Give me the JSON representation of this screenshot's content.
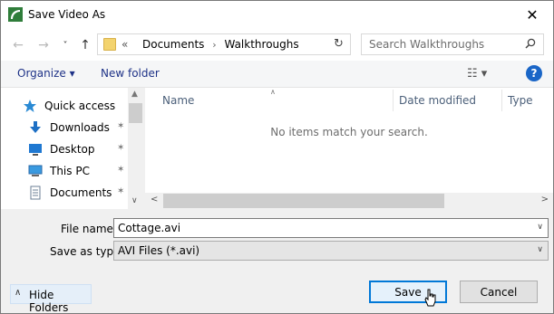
{
  "window": {
    "title": "Save Video As",
    "close_glyph": "✕"
  },
  "nav_buttons": {
    "back": "←",
    "forward": "→",
    "recent": "˅",
    "up": "↑"
  },
  "address": {
    "overflow": "«",
    "crumbs": [
      "Documents",
      "Walkthroughs"
    ],
    "separator": "›",
    "dropdown_glyph": "˅",
    "refresh_glyph": "↻"
  },
  "search": {
    "placeholder": "Search Walkthroughs"
  },
  "toolbar": {
    "organize": "Organize ▾",
    "new_folder": "New folder",
    "view": "☷  ▾",
    "help": "?"
  },
  "sidebar": {
    "items": [
      {
        "label": "Quick access",
        "icon": "star-icon",
        "pinned": false
      },
      {
        "label": "Downloads",
        "icon": "download-icon",
        "pinned": true
      },
      {
        "label": "Desktop",
        "icon": "desktop-icon",
        "pinned": true
      },
      {
        "label": "This PC",
        "icon": "computer-icon",
        "pinned": true
      },
      {
        "label": "Documents",
        "icon": "documents-icon",
        "pinned": true
      }
    ],
    "pin_glyph": "✶",
    "scroll_up": "▲",
    "scroll_down": "∨"
  },
  "file_list": {
    "columns": [
      "Name",
      "Date modified",
      "Type"
    ],
    "sort_glyph": "∧",
    "empty_message": "No items match your search.",
    "scroll_left": "<",
    "scroll_right": ">"
  },
  "form": {
    "file_name_label": "File name:",
    "file_name_value": "Cottage.avi",
    "save_as_type_label": "Save as type:",
    "save_as_type_value": "AVI Files (*.avi)",
    "dropdown_glyph": "∨"
  },
  "footer": {
    "hide_folders_glyph": "∧",
    "hide_folders": "Hide Folders",
    "save": "Save",
    "cancel": "Cancel"
  },
  "colors": {
    "accent": "#0078d7",
    "help_icon": "#1a66c7",
    "link_text": "#1e3287",
    "folder": "#f3d36e"
  }
}
